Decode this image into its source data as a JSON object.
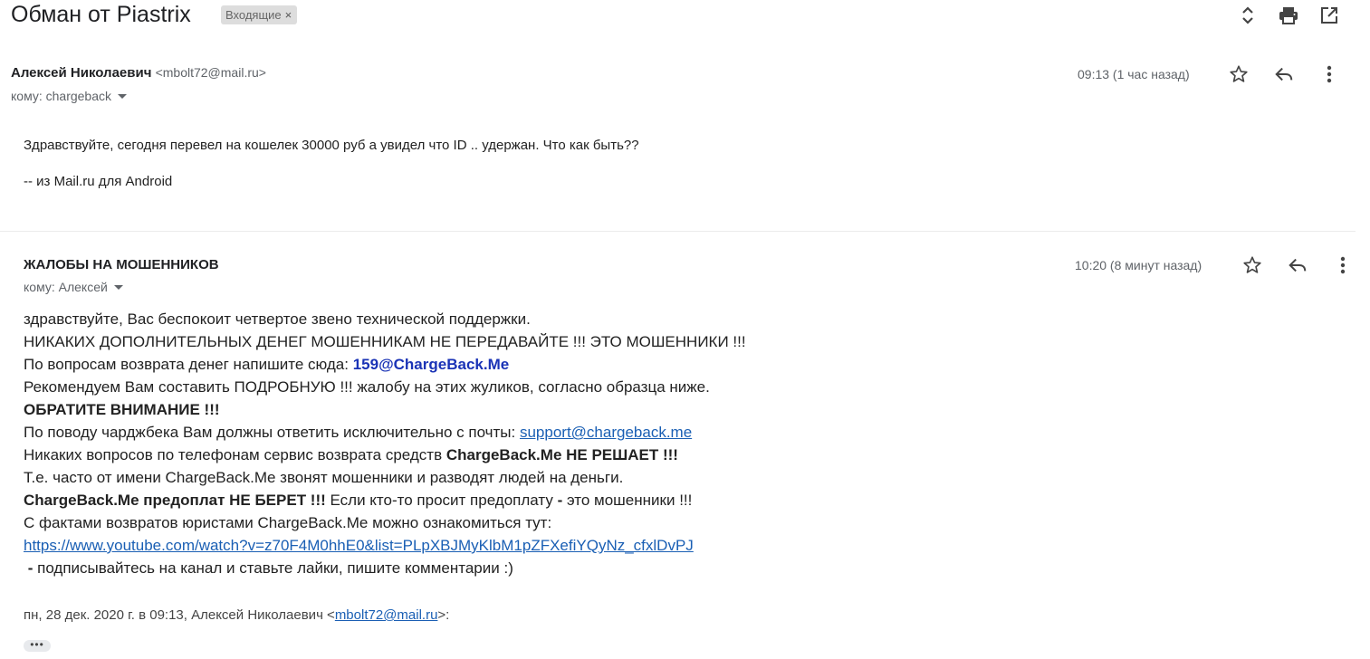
{
  "header": {
    "subject": "Обман от Piastrix",
    "label": "Входящие",
    "label_remove": "×",
    "icons": [
      "expand-collapse-icon",
      "print-icon",
      "open-new-window-icon"
    ]
  },
  "message1": {
    "sender_name": "Алексей Николаевич",
    "sender_email": "<mbolt72@mail.ru>",
    "to": "кому: chargeback",
    "time": "09:13 (1 час назад)",
    "body": [
      "Здравствуйте, сегодня перевел на кошелек 30000 руб а увидел что ID .. удержан. Что как быть??",
      "-- из Mail.ru для Android"
    ]
  },
  "message2": {
    "sender_name": "ЖАЛОБЫ НА МОШЕННИКОВ",
    "to": "кому: Алексей",
    "time": "10:20 (8 минут назад)",
    "lines": {
      "l1": "здравствуйте, Вас беспокоит четвертое звено технической поддержки.",
      "l2": "НИКАКИХ ДОПОЛНИТЕЛЬНЫХ ДЕНЕГ МОШЕННИКАМ НЕ ПЕРЕДАВАЙТЕ !!! ЭТО МОШЕННИКИ !!!",
      "l3_text": "По вопросам возврата денег напишите сюда: ",
      "l3_email": "159@ChargeBack.Me",
      "l4": "Рекомендуем Вам составить ПОДРОБНУЮ !!! жалобу на этих жуликов, согласно образца ниже.",
      "l5": "ОБРАТИТЕ ВНИМАНИЕ !!!",
      "l6_text": "По поводу чарджбека Вам должны ответить исключительно с почты: ",
      "l6_link": "support@chargeback.me",
      "l7_text": "Никаких вопросов по телефонам сервис возврата средств ",
      "l7_bold": "ChargeBack.Me НЕ РЕШАЕТ !!!",
      "l8": "Т.е. часто от имени ChargeBack.Me звонят мошенники и разводят людей на деньги.",
      "l9_bold": "ChargeBack.Me предоплат НЕ БЕРЕТ !!!",
      "l9_text": " Если кто-то просит предоплату ",
      "l9_dash": "-",
      "l9_end": " это мошенники !!!",
      "l10": "С фактами возвратов юристами ChargeBack.Me можно ознакомиться тут:",
      "l11_link": "https://www.youtube.com/watch?v=z70F4M0hhE0&list=PLpXBJMyKlbM1pZFXefiYQyNz_cfxlDvPJ",
      "l12_dash": "-",
      "l12_text": " подписывайтесь на канал и ставьте лайки, пишите комментарии :)"
    },
    "quote_prefix": "пн, 28 дек. 2020 г. в 09:13, Алексей Николаевич <",
    "quote_email": "mbolt72@mail.ru",
    "quote_suffix": ">:",
    "show_trimmed": "•••"
  },
  "colors": {
    "link": "#1a5fb4",
    "highlight_email": "#1a33b6",
    "muted": "#5f6368"
  }
}
